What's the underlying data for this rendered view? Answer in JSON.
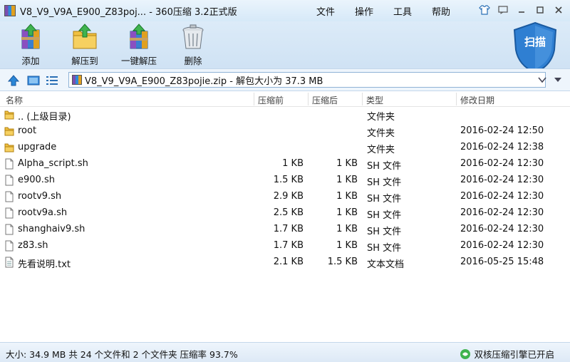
{
  "window": {
    "title": "V8_V9_V9A_E900_Z83poj... - 360压缩 3.2正式版"
  },
  "menu": [
    "文件",
    "操作",
    "工具",
    "帮助"
  ],
  "toolbar": {
    "add_label": "添加",
    "extract_to_label": "解压到",
    "one_click_extract_label": "一键解压",
    "delete_label": "删除",
    "scan_label": "扫描"
  },
  "address": {
    "path": "V8_V9_V9A_E900_Z83pojie.zip - 解包大小为 37.3 MB"
  },
  "columns": {
    "name": "名称",
    "before": "压缩前",
    "after": "压缩后",
    "type": "类型",
    "modified": "修改日期"
  },
  "files": [
    {
      "name": ".. (上级目录)",
      "before": "",
      "after": "",
      "type": "文件夹",
      "modified": "",
      "icon": "folder-icon"
    },
    {
      "name": "root",
      "before": "",
      "after": "",
      "type": "文件夹",
      "modified": "2016-02-24 12:50",
      "icon": "folder-icon"
    },
    {
      "name": "upgrade",
      "before": "",
      "after": "",
      "type": "文件夹",
      "modified": "2016-02-24 12:38",
      "icon": "folder-icon"
    },
    {
      "name": "Alpha_script.sh",
      "before": "1 KB",
      "after": "1 KB",
      "type": "SH 文件",
      "modified": "2016-02-24 12:30",
      "icon": "file-icon"
    },
    {
      "name": "e900.sh",
      "before": "1.5 KB",
      "after": "1 KB",
      "type": "SH 文件",
      "modified": "2016-02-24 12:30",
      "icon": "file-icon"
    },
    {
      "name": "rootv9.sh",
      "before": "2.9 KB",
      "after": "1 KB",
      "type": "SH 文件",
      "modified": "2016-02-24 12:30",
      "icon": "file-icon"
    },
    {
      "name": "rootv9a.sh",
      "before": "2.5 KB",
      "after": "1 KB",
      "type": "SH 文件",
      "modified": "2016-02-24 12:30",
      "icon": "file-icon"
    },
    {
      "name": "shanghaiv9.sh",
      "before": "1.7 KB",
      "after": "1 KB",
      "type": "SH 文件",
      "modified": "2016-02-24 12:30",
      "icon": "file-icon"
    },
    {
      "name": "z83.sh",
      "before": "1.7 KB",
      "after": "1 KB",
      "type": "SH 文件",
      "modified": "2016-02-24 12:30",
      "icon": "file-icon"
    },
    {
      "name": "先看说明.txt",
      "before": "2.1 KB",
      "after": "1.5 KB",
      "type": "文本文档",
      "modified": "2016-05-25 15:48",
      "icon": "text-file-icon"
    }
  ],
  "status": {
    "summary": "大小: 34.9 MB 共 24 个文件和 2 个文件夹 压缩率 93.7%",
    "engine": "双核压缩引擎已开启"
  }
}
